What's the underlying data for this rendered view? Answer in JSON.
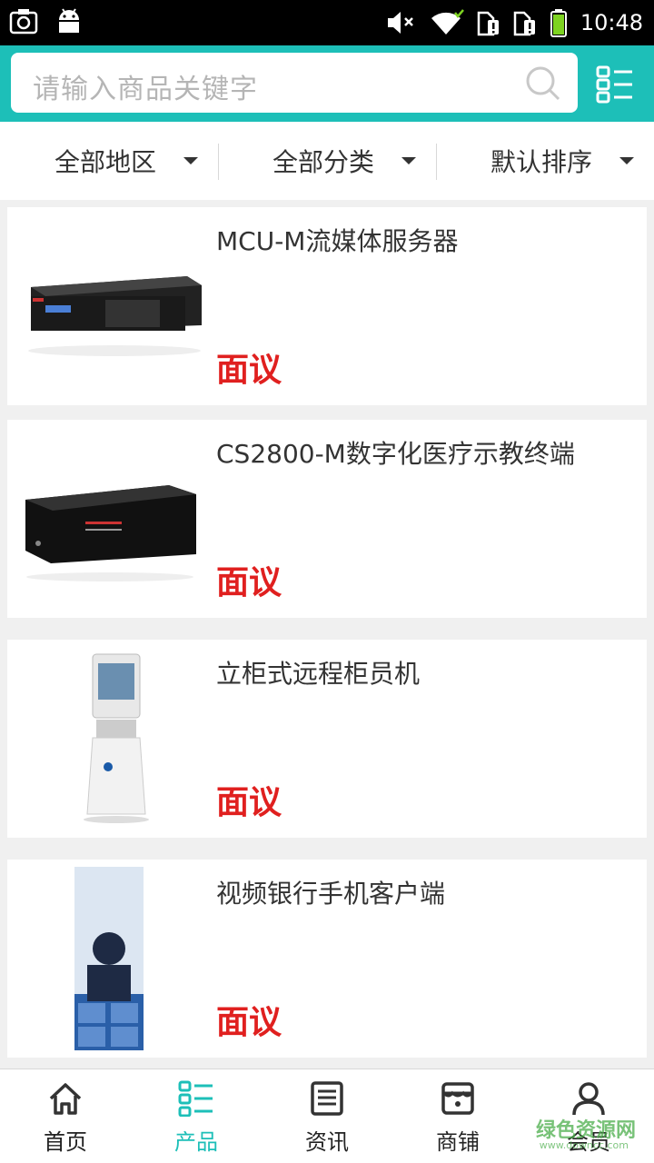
{
  "status_bar": {
    "time": "10:48"
  },
  "search": {
    "placeholder": "请输入商品关键字"
  },
  "filters": [
    {
      "label": "全部地区"
    },
    {
      "label": "全部分类"
    },
    {
      "label": "默认排序"
    }
  ],
  "products": [
    {
      "title": "MCU-M流媒体服务器",
      "price": "面议"
    },
    {
      "title": "CS2800-M数字化医疗示教终端",
      "price": "面议"
    },
    {
      "title": "立柜式远程柜员机",
      "price": "面议"
    },
    {
      "title": "视频银行手机客户端",
      "price": "面议"
    }
  ],
  "nav": [
    {
      "label": "首页",
      "icon": "home-icon"
    },
    {
      "label": "产品",
      "icon": "product-list-icon"
    },
    {
      "label": "资讯",
      "icon": "news-icon"
    },
    {
      "label": "商铺",
      "icon": "store-icon"
    },
    {
      "label": "会员",
      "icon": "user-icon"
    }
  ],
  "watermark": {
    "text": "绿色资源网",
    "sub": "www.downcc.com"
  },
  "colors": {
    "accent": "#1dbfb8",
    "price": "#e0201f"
  }
}
